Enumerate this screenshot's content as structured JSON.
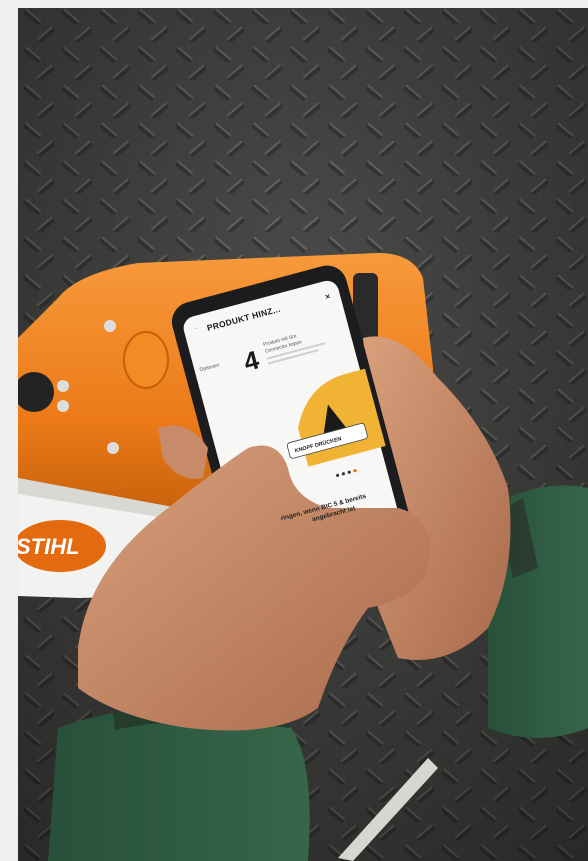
{
  "scene": {
    "brand_logo": "STIHL",
    "phone_screen": {
      "title": "PRODUKT HINZ...",
      "close_icon": "close-icon",
      "back_icon": "arrow-left-icon",
      "step_number": "4",
      "step_line1": "Produkt mit Sm",
      "step_line2": "Connector koppe",
      "side_label": "Optionen",
      "press_button_label": "KNOPF DRÜCKEN",
      "footer_line1": "ringen, wenn BIC 5 & bereits",
      "footer_line2": "angebracht ist"
    },
    "colors": {
      "background_margin": "#efefef",
      "floor": "#4a4a48",
      "machine_orange": "#f0821e",
      "sleeve_green": "#2f5a3a",
      "skin": "#c98a66",
      "phone_body": "#1c1c1e",
      "screen": "#f7f7f5",
      "accent_yellow": "#f1b334"
    }
  }
}
